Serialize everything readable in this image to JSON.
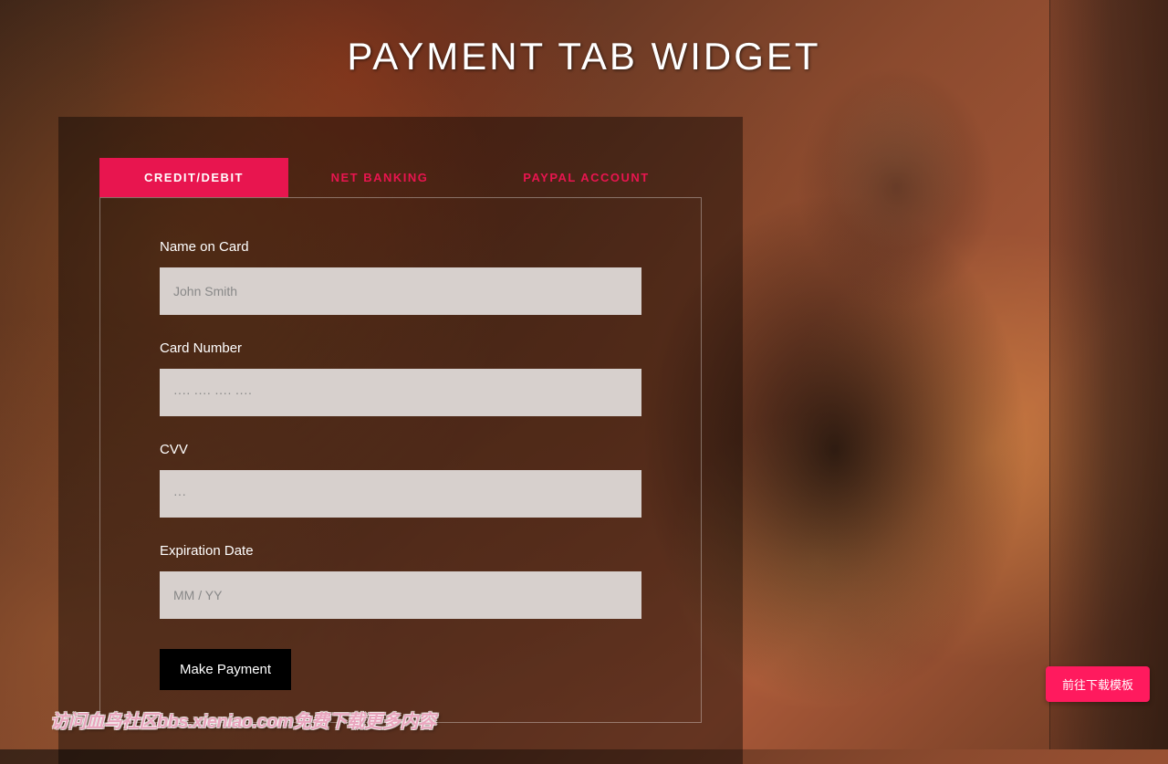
{
  "page": {
    "title": "PAYMENT TAB WIDGET"
  },
  "tabs": {
    "credit_debit": "CREDIT/DEBIT",
    "net_banking": "NET BANKING",
    "paypal": "PAYPAL ACCOUNT"
  },
  "form": {
    "name_label": "Name on Card",
    "name_placeholder": "John Smith",
    "card_label": "Card Number",
    "card_placeholder": "···· ···· ···· ····",
    "cvv_label": "CVV",
    "cvv_placeholder": "···",
    "expiry_label": "Expiration Date",
    "expiry_placeholder": "MM / YY",
    "submit_label": "Make Payment"
  },
  "download_button": "前往下载模板",
  "watermark": "访问血鸟社区bbs.xieniao.com免费下载更多内容"
}
